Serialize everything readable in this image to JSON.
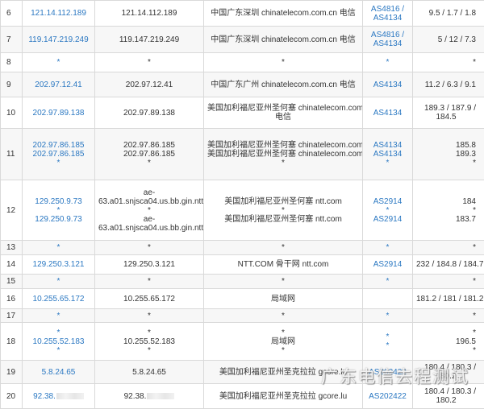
{
  "rows": [
    {
      "hop": "6",
      "ip": [
        "121.14.112.189"
      ],
      "host": [
        "121.14.112.189"
      ],
      "loc": [
        "中国广东深圳 chinatelecom.com.cn 电信"
      ],
      "asn": [
        "AS4816 /",
        "AS4134"
      ],
      "rtt": [
        "9.5 / 1.7 / 1.8"
      ]
    },
    {
      "hop": "7",
      "ip": [
        "119.147.219.249"
      ],
      "host": [
        "119.147.219.249"
      ],
      "loc": [
        "中国广东深圳 chinatelecom.com.cn 电信"
      ],
      "asn": [
        "AS4816 /",
        "AS4134"
      ],
      "rtt": [
        "5 / 12 / 7.3"
      ]
    },
    {
      "hop": "8",
      "ip": [
        "*"
      ],
      "host": [
        "*"
      ],
      "loc": [
        "*"
      ],
      "asn": [
        "*"
      ],
      "rtt": [
        "*"
      ]
    },
    {
      "hop": "9",
      "ip": [
        "202.97.12.41"
      ],
      "host": [
        "202.97.12.41"
      ],
      "loc": [
        "中国广东广州 chinatelecom.com.cn 电信"
      ],
      "asn": [
        "AS4134"
      ],
      "rtt": [
        "11.2 / 6.3 / 9.1"
      ]
    },
    {
      "hop": "10",
      "ip": [
        "202.97.89.138"
      ],
      "host": [
        "202.97.89.138"
      ],
      "loc": [
        "美国加利福尼亚州圣何塞 chinatelecom.com.cn",
        "电信"
      ],
      "asn": [
        "AS4134"
      ],
      "rtt": [
        "189.3 / 187.9 /",
        "184.5"
      ]
    },
    {
      "hop": "11",
      "ip": [
        "202.97.86.185",
        "202.97.86.185",
        "*"
      ],
      "host": [
        "202.97.86.185",
        "202.97.86.185",
        "*"
      ],
      "loc": [
        "美国加利福尼亚州圣何塞 chinatelecom.com.cn 电信",
        "美国加利福尼亚州圣何塞 chinatelecom.com.cn 电信",
        "*"
      ],
      "asn": [
        "AS4134",
        "AS4134",
        "*"
      ],
      "rtt": [
        "185.8",
        "189.3",
        "*"
      ]
    },
    {
      "hop": "12",
      "ip": [
        "129.250.9.73",
        "*",
        "129.250.9.73"
      ],
      "host": [
        "ae-",
        "63.a01.snjsca04.us.bb.gin.ntt.net",
        "*",
        "ae-",
        "63.a01.snjsca04.us.bb.gin.ntt.net"
      ],
      "loc": [
        "美国加利福尼亚州圣何塞 ntt.com",
        "*",
        "美国加利福尼亚州圣何塞 ntt.com"
      ],
      "asn": [
        "AS2914",
        "*",
        "AS2914"
      ],
      "rtt": [
        "184",
        "*",
        "183.7"
      ]
    },
    {
      "hop": "13",
      "ip": [
        "*"
      ],
      "host": [
        "*"
      ],
      "loc": [
        "*"
      ],
      "asn": [
        "*"
      ],
      "rtt": [
        "*"
      ]
    },
    {
      "hop": "14",
      "ip": [
        "129.250.3.121"
      ],
      "host": [
        "129.250.3.121"
      ],
      "loc": [
        "NTT.COM 骨干网 ntt.com"
      ],
      "asn": [
        "AS2914"
      ],
      "rtt": [
        "232 / 184.8 / 184.7"
      ]
    },
    {
      "hop": "15",
      "ip": [
        "*"
      ],
      "host": [
        "*"
      ],
      "loc": [
        "*"
      ],
      "asn": [
        "*"
      ],
      "rtt": [
        "*"
      ]
    },
    {
      "hop": "16",
      "ip": [
        "10.255.65.172"
      ],
      "host": [
        "10.255.65.172"
      ],
      "loc": [
        "局域网"
      ],
      "asn": [
        ""
      ],
      "rtt": [
        "181.2 / 181 / 181.2"
      ]
    },
    {
      "hop": "17",
      "ip": [
        "*"
      ],
      "host": [
        "*"
      ],
      "loc": [
        "*"
      ],
      "asn": [
        "*"
      ],
      "rtt": [
        "*"
      ]
    },
    {
      "hop": "18",
      "ip": [
        "*",
        "10.255.52.183",
        "*"
      ],
      "host": [
        "*",
        "10.255.52.183",
        "*"
      ],
      "loc": [
        "*",
        "局域网",
        "*"
      ],
      "asn": [
        "*",
        "",
        "*"
      ],
      "rtt": [
        "*",
        "196.5",
        "*"
      ]
    },
    {
      "hop": "19",
      "ip": [
        "5.8.24.65"
      ],
      "host": [
        "5.8.24.65"
      ],
      "loc": [
        "美国加利福尼亚州圣克拉拉 gcore.lu"
      ],
      "asn": [
        "AS202422"
      ],
      "rtt": [
        "180.4 / 180.3 /",
        "180.2"
      ]
    },
    {
      "hop": "20",
      "ip": [
        "92.38."
      ],
      "host": [
        "92.38."
      ],
      "loc": [
        "美国加利福尼亚州圣克拉拉 gcore.lu"
      ],
      "asn": [
        "AS202422"
      ],
      "rtt": [
        "180.4 / 180.3 /",
        "180.2"
      ]
    }
  ],
  "watermark": "广东电信去程测试",
  "colors": {
    "link": "#2b78c2",
    "border": "#d9d9d9",
    "stripe": "#f7f7f7"
  }
}
